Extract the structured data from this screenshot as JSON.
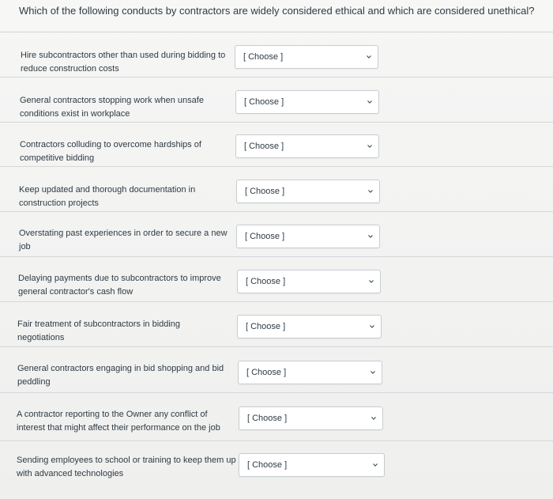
{
  "question": {
    "prompt": "Which of the following conducts by contractors are widely considered ethical and which are considered unethical?"
  },
  "rows": [
    {
      "statement": "Hire subcontractors other than used during bidding to reduce construction costs",
      "selected": "[ Choose ]"
    },
    {
      "statement": "General contractors stopping work when unsafe conditions exist in workplace",
      "selected": "[ Choose ]"
    },
    {
      "statement": "Contractors colluding to overcome hardships of competitive bidding",
      "selected": "[ Choose ]"
    },
    {
      "statement": "Keep updated and thorough documentation in construction projects",
      "selected": "[ Choose ]"
    },
    {
      "statement": "Overstating past experiences in order to secure a new job",
      "selected": "[ Choose ]"
    },
    {
      "statement": "Delaying payments due to subcontractors to improve general contractor's cash flow",
      "selected": "[ Choose ]"
    },
    {
      "statement": "Fair treatment of subcontractors in bidding negotiations",
      "selected": "[ Choose ]"
    },
    {
      "statement": "General contractors engaging in bid shopping and bid peddling",
      "selected": "[ Choose ]"
    },
    {
      "statement": "A contractor reporting to the Owner any conflict of interest that might affect their performance on the job",
      "selected": "[ Choose ]"
    },
    {
      "statement": "Sending employees to school or training to keep them up with advanced technologies",
      "selected": "[ Choose ]"
    }
  ],
  "icons": {
    "dropdown": "chevron-down-icon"
  },
  "colors": {
    "text": "#2d3b45",
    "border": "#c7cdd1",
    "background": "#f2f2f1"
  }
}
